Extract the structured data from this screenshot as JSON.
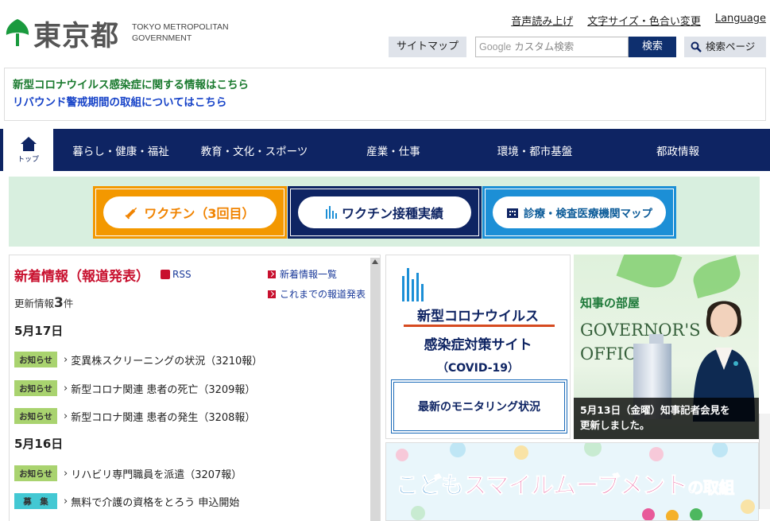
{
  "header": {
    "logo_jp": "東京都",
    "logo_en_line1": "TOKYO METROPOLITAN",
    "logo_en_line2": "GOVERNMENT",
    "util_links": [
      "音声読み上げ",
      "文字サイズ・色合い変更",
      "Language"
    ],
    "sitemap_label": "サイトマップ",
    "search_brand": "Google",
    "search_placeholder": "カスタム検索",
    "search_button": "検索",
    "search_page_button": "検索ページ"
  },
  "notice": {
    "line1": "新型コロナウイルス感染症に関する情報はこちら",
    "line2": "リバウンド警戒期間の取組についてはこちら"
  },
  "nav": {
    "home_label": "トップ",
    "items": [
      "暮らし・健康・福祉",
      "教育・文化・スポーツ",
      "産業・仕事",
      "環境・都市基盤",
      "都政情報"
    ]
  },
  "banners": {
    "vaccine3": "ワクチン（3回目）",
    "vaccine_results": "ワクチン接種実績",
    "clinic_map": "診療・検査医療機関マップ"
  },
  "news": {
    "title": "新着情報（報道発表）",
    "rss": "RSS",
    "link_list": "新着情報一覧",
    "link_past": "これまでの報道発表",
    "update_prefix": "更新情報",
    "update_count": "3",
    "update_suffix": "件",
    "groups": [
      {
        "date": "5月17日",
        "items": [
          {
            "tag": "お知らせ",
            "text": "変異株スクリーニングの状況（3210報）"
          },
          {
            "tag": "お知らせ",
            "text": "新型コロナ関連 患者の死亡（3209報）"
          },
          {
            "tag": "お知らせ",
            "text": "新型コロナ関連 患者の発生（3208報）"
          }
        ]
      },
      {
        "date": "5月16日",
        "items": [
          {
            "tag": "お知らせ",
            "text": "リハビリ専門職員を派遣（3207報）"
          },
          {
            "tag": "募　集",
            "text": "無料で介護の資格をとろう 申込開始"
          }
        ]
      }
    ]
  },
  "covid": {
    "line1": "新型コロナウイルス",
    "line2": "感染症対策サイト",
    "line3": "（COVID-19）",
    "monitoring": "最新のモニタリング状況"
  },
  "governor": {
    "jp": "知事の部屋",
    "en_line1": "GOVERNOR'S",
    "en_line2": "OFFICE",
    "caption_line1": "5月13日（金曜）知事記者会見を",
    "caption_line2": "更新しました。"
  },
  "kodomo": {
    "part1": "こども",
    "part2": "スマイルムーブメント",
    "part3": "の取組"
  },
  "colors": {
    "navy": "#0e2463",
    "orange": "#f39800",
    "blue": "#1c8fd6",
    "red": "#c8102e",
    "green_text": "#1a7a2e",
    "blue_text": "#1743c8"
  }
}
